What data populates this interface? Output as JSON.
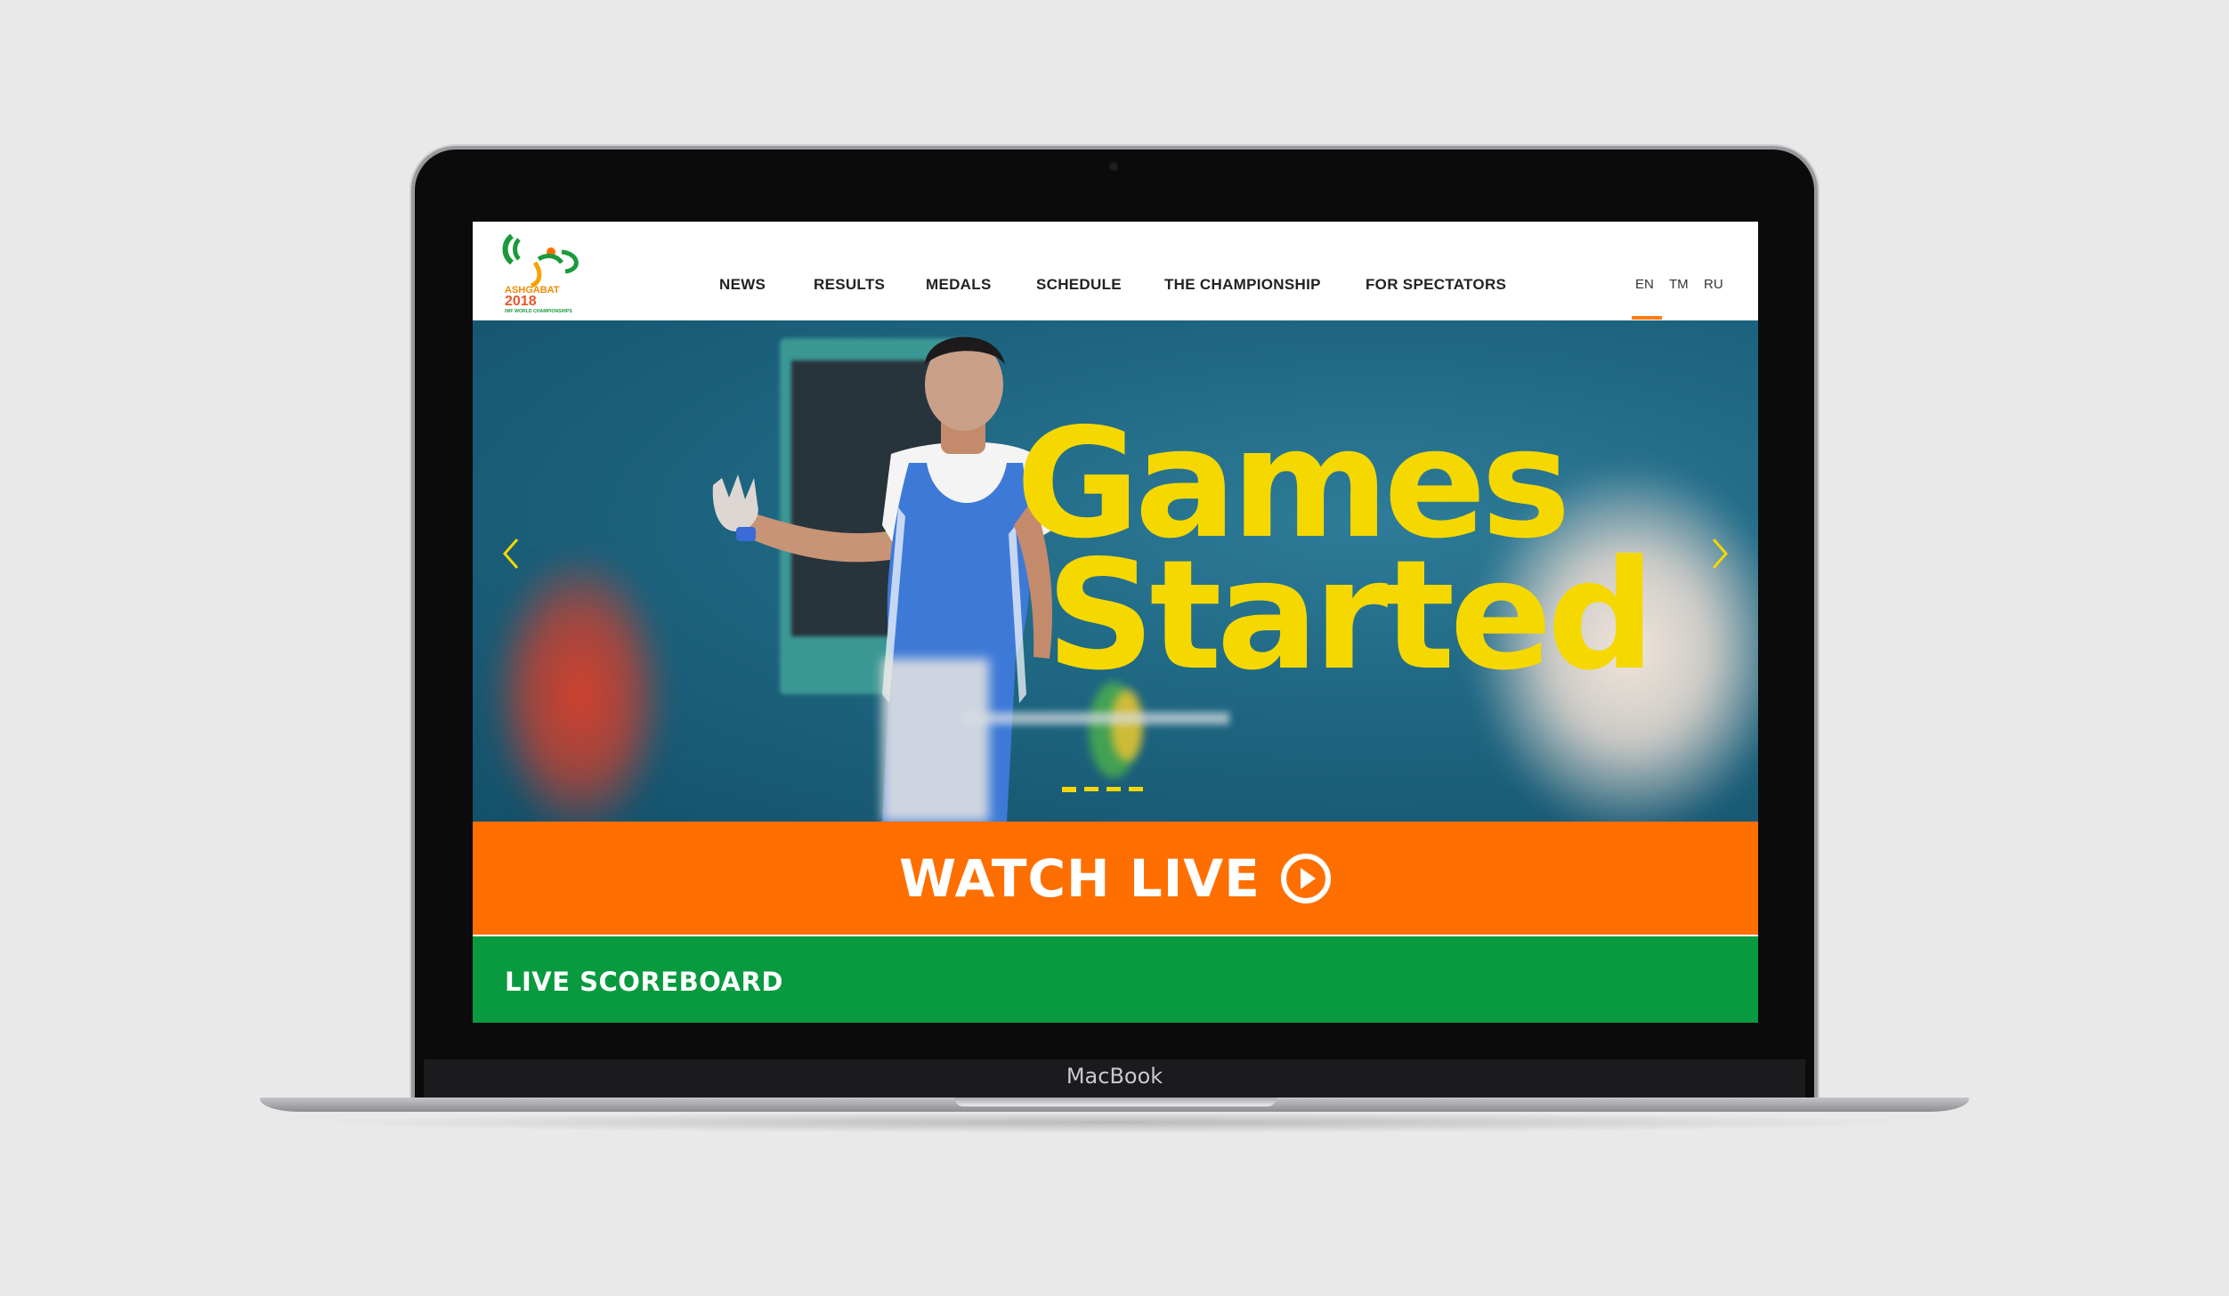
{
  "device": {
    "label": "MacBook"
  },
  "logo": {
    "city": "ASHGABAT",
    "year": "2018",
    "tagline": "IWF WORLD CHAMPIONSHIPS"
  },
  "nav": {
    "items": [
      {
        "label": "NEWS"
      },
      {
        "label": "RESULTS"
      },
      {
        "label": "MEDALS"
      },
      {
        "label": "SCHEDULE"
      },
      {
        "label": "THE CHAMPIONSHIP"
      },
      {
        "label": "FOR SPECTATORS"
      }
    ]
  },
  "languages": {
    "items": [
      "EN",
      "TM",
      "RU"
    ],
    "active": "EN"
  },
  "hero": {
    "title_line1": "Games",
    "title_line2": "Started",
    "slide_count": 4,
    "active_slide": 1
  },
  "watch_live": {
    "label": "WATCH LIVE"
  },
  "scoreboard": {
    "label": "LIVE SCOREBOARD"
  },
  "colors": {
    "accent_orange": "#ff6f00",
    "accent_green": "#099a40",
    "hero_yellow": "#f5d800",
    "language_indicator": "#ff7a14"
  }
}
